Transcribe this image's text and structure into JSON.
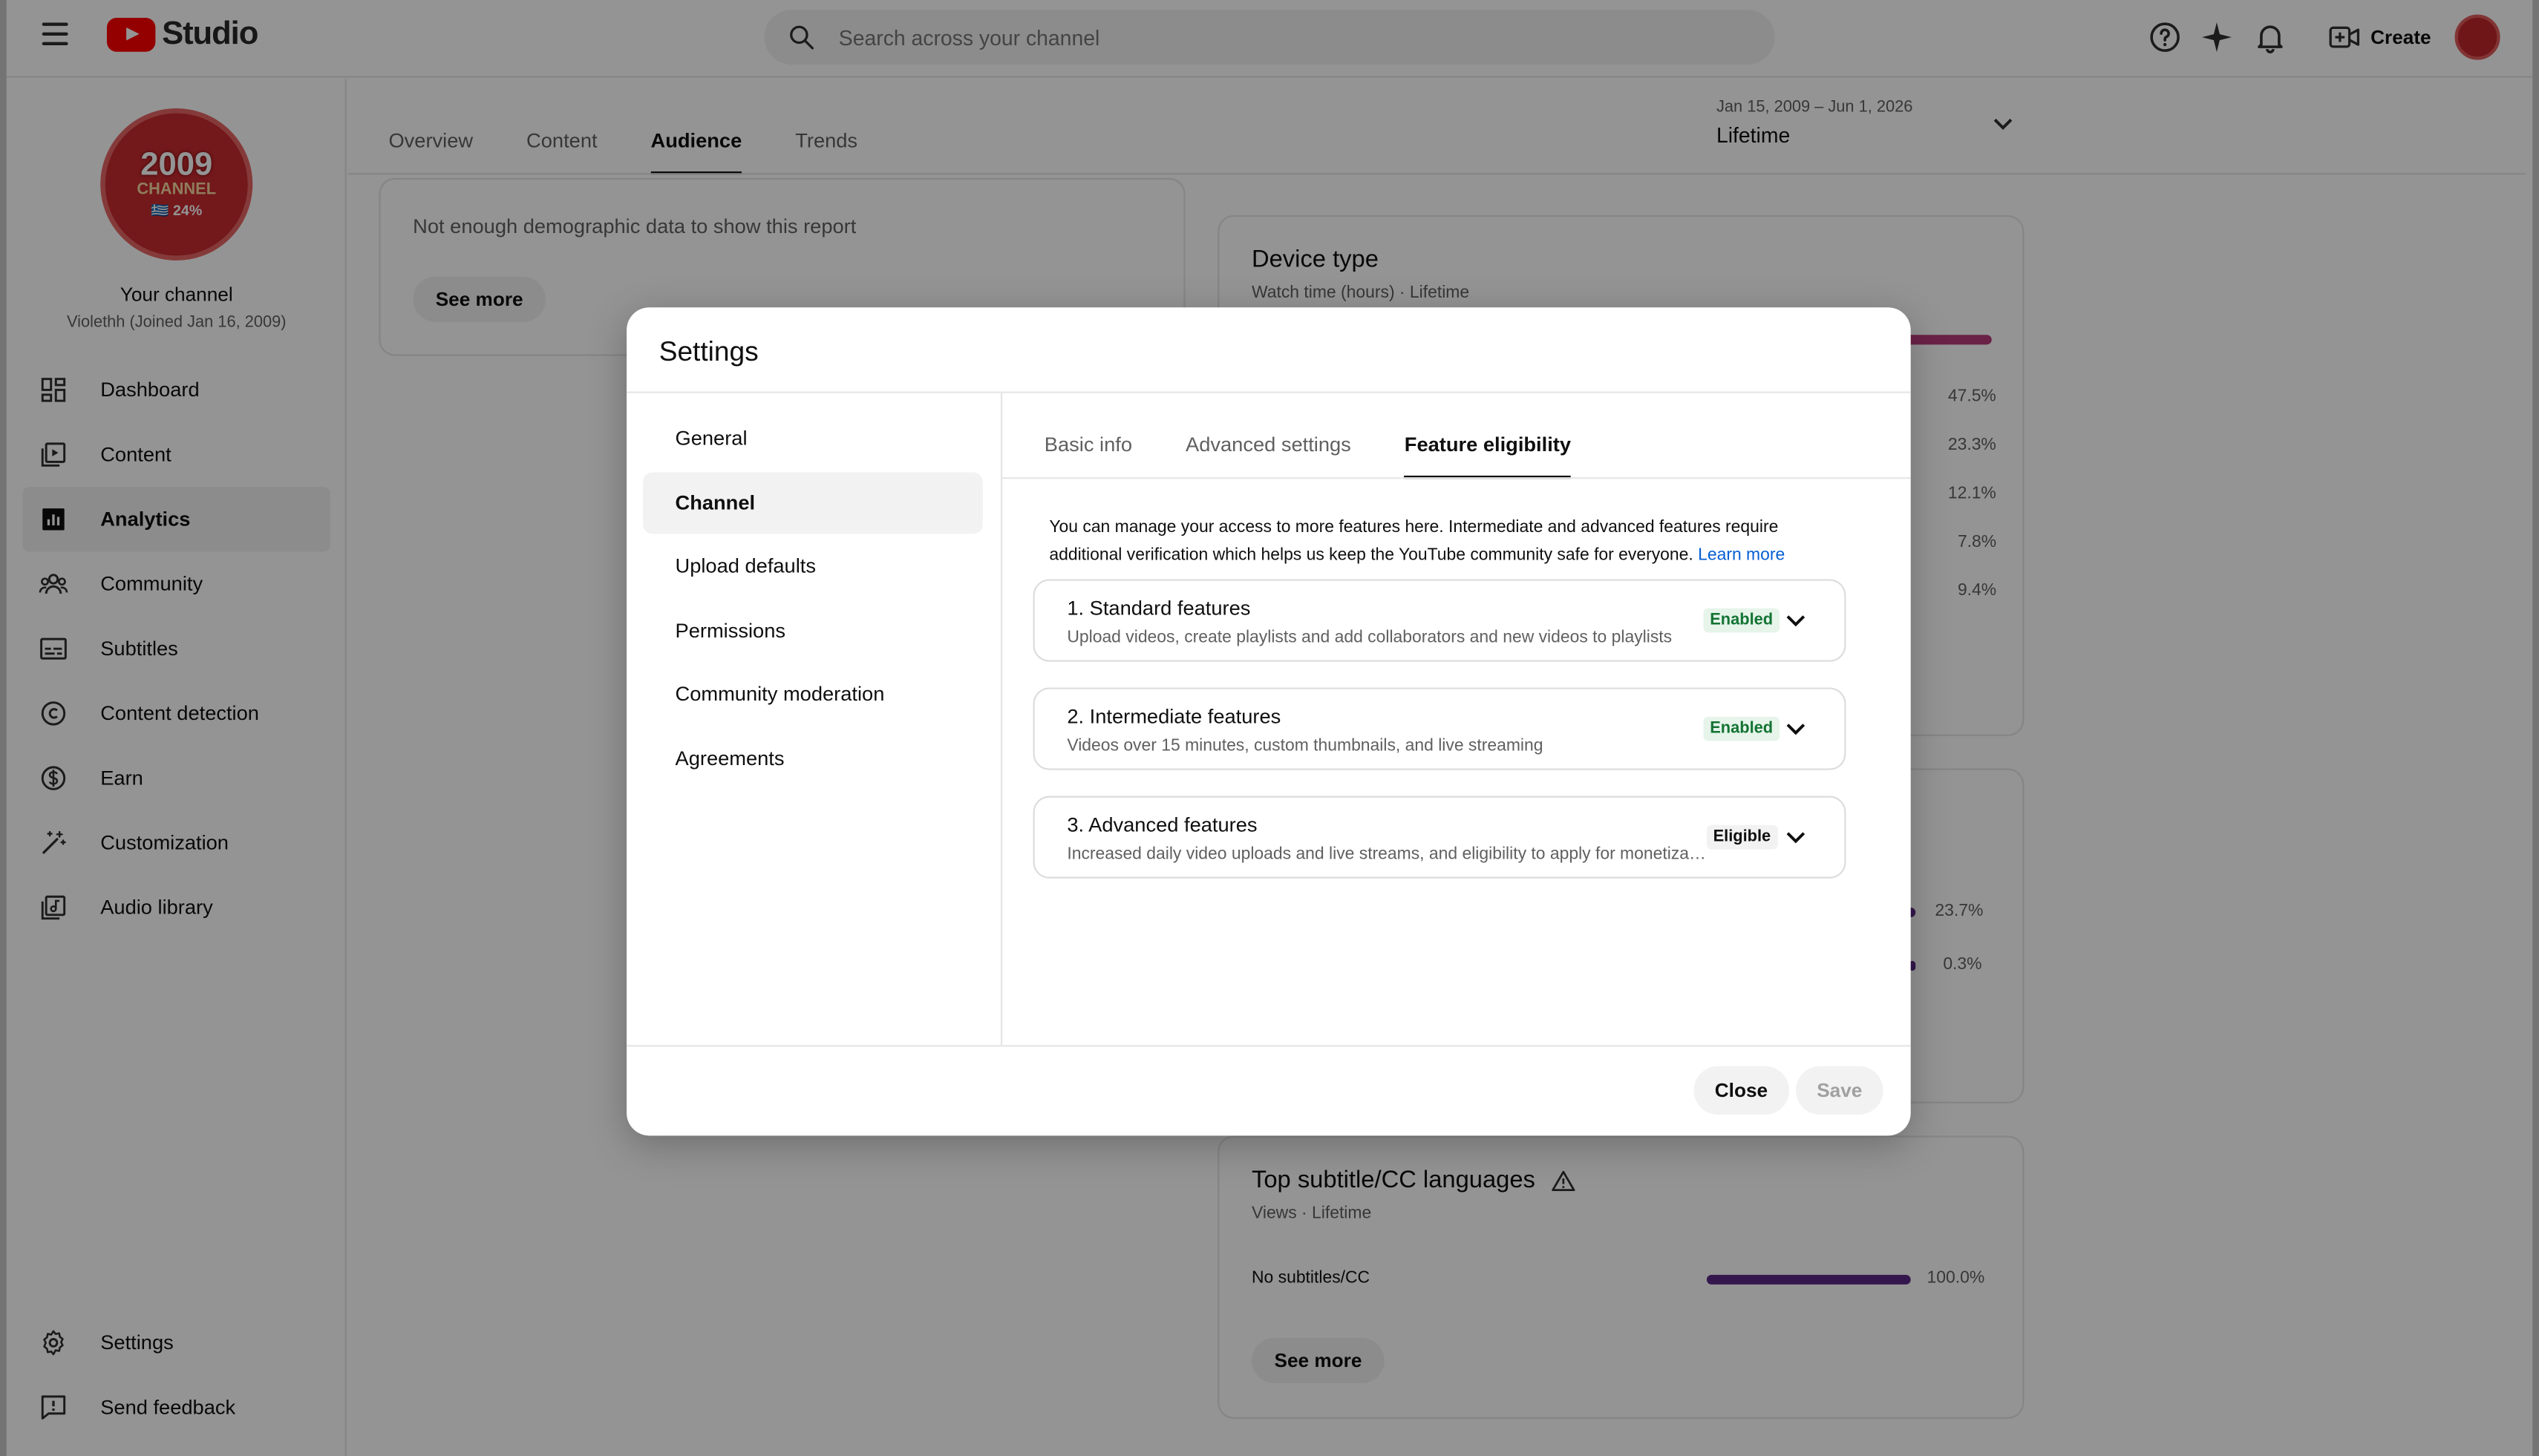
{
  "header": {
    "logo_text": "Studio",
    "search_placeholder": "Search across your channel",
    "create_label": "Create"
  },
  "sidebar": {
    "avatar": {
      "line1": "2009",
      "line2": "CHANNEL",
      "line3": "🇬🇷 24%"
    },
    "channel_title": "Your channel",
    "channel_subtitle": "Violethh (Joined Jan 16, 2009)",
    "items": [
      {
        "label": "Dashboard",
        "icon": "dashboard-icon"
      },
      {
        "label": "Content",
        "icon": "content-icon"
      },
      {
        "label": "Analytics",
        "icon": "analytics-icon",
        "active": true
      },
      {
        "label": "Community",
        "icon": "community-icon"
      },
      {
        "label": "Subtitles",
        "icon": "subtitles-icon"
      },
      {
        "label": "Content detection",
        "icon": "copyright-icon"
      },
      {
        "label": "Earn",
        "icon": "dollar-icon"
      },
      {
        "label": "Customization",
        "icon": "magic-wand-icon"
      },
      {
        "label": "Audio library",
        "icon": "audio-library-icon"
      }
    ],
    "bottom_items": [
      {
        "label": "Settings",
        "icon": "gear-icon"
      },
      {
        "label": "Send feedback",
        "icon": "feedback-icon"
      }
    ]
  },
  "main": {
    "tabs": [
      {
        "label": "Overview"
      },
      {
        "label": "Content"
      },
      {
        "label": "Audience",
        "active": true
      },
      {
        "label": "Trends"
      }
    ],
    "date_range": {
      "range": "Jan 15, 2009 – Jun 1, 2026",
      "label": "Lifetime"
    },
    "demographics": {
      "message": "Not enough demographic data to show this report",
      "button": "See more"
    },
    "device_type": {
      "title": "Device type",
      "subtitle": "Watch time (hours) · Lifetime",
      "percentages": [
        "47.5%",
        "23.3%",
        "12.1%",
        "7.8%",
        "9.4%"
      ]
    },
    "middle_card": {
      "percentages": [
        "23.7%",
        "0.3%"
      ]
    },
    "subtitles_card": {
      "title": "Top subtitle/CC languages",
      "subtitle": "Views · Lifetime",
      "row_label": "No subtitles/CC",
      "row_value": "100.0%",
      "button": "See more"
    }
  },
  "dialog": {
    "title": "Settings",
    "nav": [
      {
        "label": "General"
      },
      {
        "label": "Channel",
        "active": true
      },
      {
        "label": "Upload defaults"
      },
      {
        "label": "Permissions"
      },
      {
        "label": "Community moderation"
      },
      {
        "label": "Agreements"
      }
    ],
    "tabs": [
      {
        "label": "Basic info"
      },
      {
        "label": "Advanced settings"
      },
      {
        "label": "Feature eligibility",
        "active": true
      }
    ],
    "description": "You can manage your access to more features here. Intermediate and advanced features require additional verification which helps us keep the YouTube community safe for everyone.",
    "learn_more": "Learn more",
    "features": [
      {
        "title": "1. Standard features",
        "desc": "Upload videos, create playlists and add collaborators and new videos to playlists",
        "status": "Enabled"
      },
      {
        "title": "2. Intermediate features",
        "desc": "Videos over 15 minutes, custom thumbnails, and live streaming",
        "status": "Enabled"
      },
      {
        "title": "3. Advanced features",
        "desc": "Increased daily video uploads and live streams, and eligibility to apply for monetization",
        "status": "Eligible"
      }
    ],
    "close_label": "Close",
    "save_label": "Save"
  },
  "colors": {
    "brand_red": "#ff0000",
    "link_blue": "#065fd4",
    "enabled_green": "#137333",
    "device_bar": "#b83c7a",
    "subtitle_bar": "#5b2a86"
  }
}
